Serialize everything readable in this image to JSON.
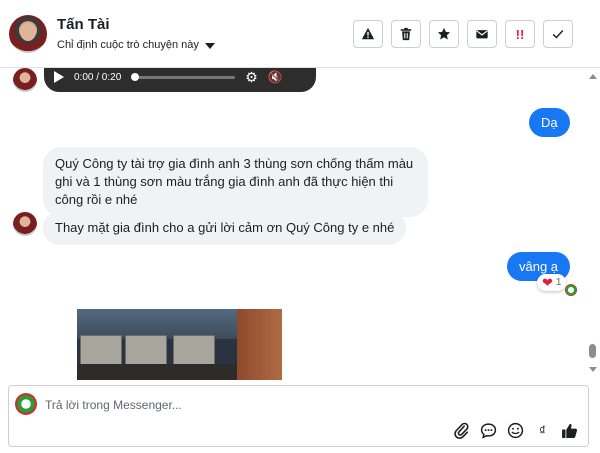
{
  "header": {
    "name": "Tấn Tài",
    "assign_label": "Chỉ định cuộc trò chuyện này",
    "actions": [
      {
        "name": "spam-warning",
        "icon": "warning-triangle-icon"
      },
      {
        "name": "delete",
        "icon": "trash-icon"
      },
      {
        "name": "star",
        "icon": "star-icon"
      },
      {
        "name": "mark-unread",
        "icon": "envelope-icon"
      },
      {
        "name": "follow-up",
        "icon": "double-exclamation-icon",
        "label": "!!"
      },
      {
        "name": "done",
        "icon": "checkmark-icon"
      }
    ]
  },
  "conversation": {
    "audio": {
      "time": "0:00 / 0:20"
    },
    "messages": [
      {
        "direction": "out",
        "text": "Dạ"
      },
      {
        "direction": "in",
        "text": "Quý Công ty tài trợ gia đình anh 3 thùng sơn chống thấm màu ghi và 1 thùng sơn màu trắng gia đình anh đã thực hiện thi công rồi e nhé"
      },
      {
        "direction": "in",
        "text": "Thay mặt gia đình cho a gửi lời cảm ơn Quý Công ty e nhé"
      },
      {
        "direction": "out",
        "text": "vâng ạ"
      }
    ],
    "reaction": {
      "emoji": "❤",
      "count": "1"
    }
  },
  "composer": {
    "placeholder": "Trả lời trong Messenger...",
    "tools": [
      "attachment-icon",
      "chat-bubble-icon",
      "emoji-icon",
      "currency-icon",
      "thumbs-up-icon"
    ]
  },
  "colors": {
    "accent": "#1877f2",
    "incoming_bubble": "#f0f2f5",
    "heart": "#e41e3f"
  }
}
